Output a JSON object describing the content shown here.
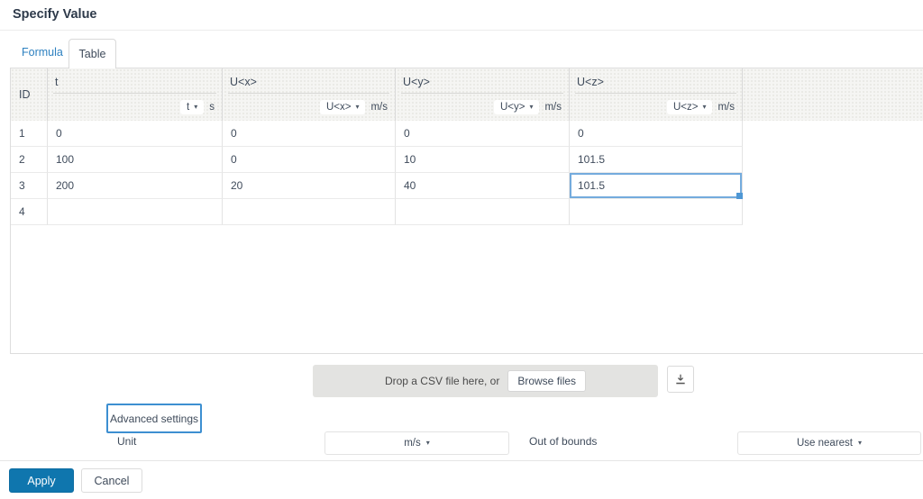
{
  "dialog": {
    "title": "Specify Value"
  },
  "tabs": [
    {
      "label": "Formula",
      "active": false
    },
    {
      "label": "Table",
      "active": true
    }
  ],
  "table": {
    "id_header": "ID",
    "columns": [
      {
        "name": "t",
        "unit_selector": "t",
        "unit": "s"
      },
      {
        "name": "U<x>",
        "unit_selector": "U<x>",
        "unit": "m/s"
      },
      {
        "name": "U<y>",
        "unit_selector": "U<y>",
        "unit": "m/s"
      },
      {
        "name": "U<z>",
        "unit_selector": "U<z>",
        "unit": "m/s"
      }
    ],
    "rows": [
      {
        "id": "1",
        "values": [
          "0",
          "0",
          "0",
          "0"
        ]
      },
      {
        "id": "2",
        "values": [
          "100",
          "0",
          "10",
          "101.5"
        ]
      },
      {
        "id": "3",
        "values": [
          "200",
          "20",
          "40",
          "101.5"
        ]
      },
      {
        "id": "4",
        "values": [
          "",
          "",
          "",
          ""
        ]
      }
    ],
    "selected_cell": {
      "row_index": 2,
      "col_index": 3,
      "value": "101.5"
    }
  },
  "csv": {
    "drop_text": "Drop a CSV file here, or",
    "browse_label": "Browse files"
  },
  "settings": {
    "advanced_button_label": "Advanced settings",
    "unit_label": "Unit",
    "unit_value": "m/s",
    "out_of_bounds_label": "Out of bounds",
    "out_of_bounds_value": "Use nearest"
  },
  "footer": {
    "apply_label": "Apply",
    "cancel_label": "Cancel"
  },
  "colors": {
    "accent_blue": "#0f76ae",
    "selection_blue": "#74abdd",
    "focus_blue": "#3d8fd1",
    "link_blue": "#2e81c0"
  },
  "glyphs": {
    "caret_down": "▾"
  }
}
